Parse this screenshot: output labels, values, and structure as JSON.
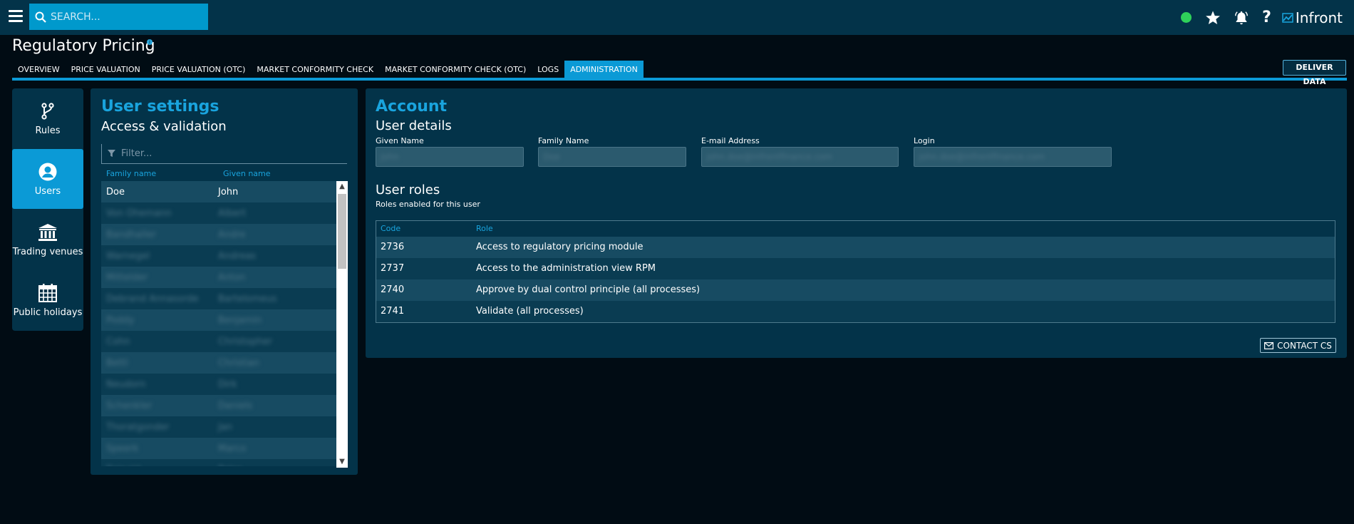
{
  "topbar": {
    "search_placeholder": "SEARCH...",
    "brand": "Infront",
    "status_color": "#2fd15a",
    "accent_color": "#0099cc",
    "icons": [
      "menu-icon",
      "search-icon",
      "star-icon",
      "bell-icon",
      "help-icon",
      "infront-logo-icon"
    ]
  },
  "header": {
    "title": "Regulatory Pricing",
    "info_glyph": "i",
    "tabs": [
      {
        "label": "OVERVIEW"
      },
      {
        "label": "PRICE VALUATION"
      },
      {
        "label": "PRICE VALUATION (OTC)"
      },
      {
        "label": "MARKET CONFORMITY CHECK"
      },
      {
        "label": "MARKET CONFORMITY CHECK (OTC)"
      },
      {
        "label": "LOGS"
      },
      {
        "label": "ADMINISTRATION",
        "active": true
      }
    ],
    "deliver_label": "DELIVER DATA"
  },
  "sidebar": {
    "items": [
      {
        "label": "Rules",
        "icon": "branch-icon"
      },
      {
        "label": "Users",
        "icon": "user-icon",
        "active": true
      },
      {
        "label": "Trading venues",
        "icon": "bank-icon"
      },
      {
        "label": "Public holidays",
        "icon": "calendar-icon"
      }
    ]
  },
  "users": {
    "title": "User settings",
    "subtitle": "Access & validation",
    "filter_placeholder": "Filter...",
    "col_family": "Family name",
    "col_given": "Given name",
    "rows": [
      {
        "family": "Doe",
        "given": "John",
        "blurred": false
      },
      {
        "family": "Von Ohemann",
        "given": "Albert",
        "blurred": true
      },
      {
        "family": "Bandhaller",
        "given": "Andre",
        "blurred": true
      },
      {
        "family": "Warnegel",
        "given": "Andreas",
        "blurred": true
      },
      {
        "family": "Mittelder",
        "given": "Anton",
        "blurred": true
      },
      {
        "family": "Debrand Annasorde",
        "given": "Bartelomeus",
        "blurred": true
      },
      {
        "family": "Poddy",
        "given": "Benjamin",
        "blurred": true
      },
      {
        "family": "Cohn",
        "given": "Christopher",
        "blurred": true
      },
      {
        "family": "Bettl",
        "given": "Christian",
        "blurred": true
      },
      {
        "family": "Neudorn",
        "given": "Dirk",
        "blurred": true
      },
      {
        "family": "Schenkler",
        "given": "Daniels",
        "blurred": true
      },
      {
        "family": "Thoratgonder",
        "given": "Jan",
        "blurred": true
      },
      {
        "family": "Speerk",
        "given": "Marco",
        "blurred": true
      },
      {
        "family": "Reinold",
        "given": "Peter",
        "blurred": true
      }
    ]
  },
  "account": {
    "title": "Account",
    "details_title": "User details",
    "fields": [
      {
        "label": "Given Name",
        "value": "John"
      },
      {
        "label": "Family Name",
        "value": "Doe"
      },
      {
        "label": "E-mail Address",
        "value": "john.doe@infrontfinance.com"
      },
      {
        "label": "Login",
        "value": "john.doe@infrontfinance.com"
      }
    ],
    "roles_title": "User roles",
    "roles_caption": "Roles enabled for this user",
    "roles_headers": {
      "code": "Code",
      "role": "Role"
    },
    "roles": [
      {
        "code": "2736",
        "role": "Access to regulatory pricing module"
      },
      {
        "code": "2737",
        "role": "Access to the administration view RPM"
      },
      {
        "code": "2740",
        "role": "Approve by dual control principle (all processes)"
      },
      {
        "code": "2741",
        "role": "Validate (all processes)"
      }
    ],
    "contact_label": "CONTACT CS"
  }
}
